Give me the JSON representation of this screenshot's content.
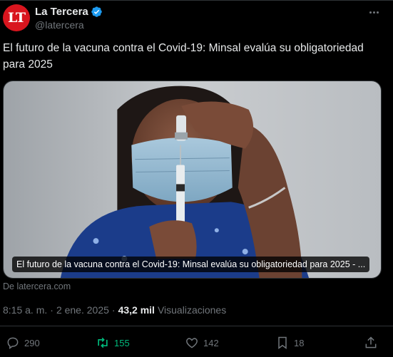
{
  "account": {
    "avatar_text": "LT",
    "display_name": "La Tercera",
    "handle": "@latercera"
  },
  "tweet": {
    "text": "El futuro de la vacuna contra el Covid-19: Minsal evalúa su obligatoriedad para 2025"
  },
  "card": {
    "caption": "El futuro de la vacuna contra el Covid-19: Minsal evalúa su obligatoriedad para 2025 - ...",
    "source": "De latercera.com"
  },
  "meta": {
    "time": "8:15 a. m.",
    "date": "2 ene. 2025",
    "views_count": "43,2 mil",
    "views_label": "Visualizaciones"
  },
  "actions": {
    "replies": "290",
    "reposts": "155",
    "likes": "142",
    "bookmarks": "18"
  },
  "colors": {
    "background": "#000000",
    "verified": "#1d9bf0",
    "repost_active": "#00ba7c",
    "avatar_bg": "#d9151e"
  }
}
